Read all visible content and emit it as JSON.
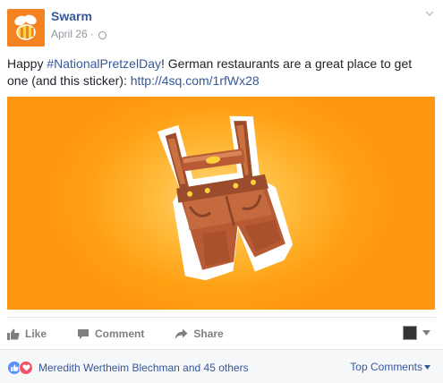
{
  "post": {
    "page_name": "Swarm",
    "date": "April 26",
    "dot": "·",
    "text_prefix": "Happy ",
    "hashtag": "#NationalPretzelDay",
    "text_mid": "! German restaurants are a great place to get one (and this sticker): ",
    "link": "http://4sq.com/1rfWx28"
  },
  "actions": {
    "like": "Like",
    "comment": "Comment",
    "share": "Share"
  },
  "footer": {
    "reactors": "Meredith Wertheim Blechman and 45 others",
    "sort": "Top Comments"
  },
  "colors": {
    "brand_orange": "#f48220",
    "link_blue": "#365899",
    "like_blue": "#5890ff",
    "love_red": "#f25268",
    "photo_orange": "#ff9f12"
  }
}
